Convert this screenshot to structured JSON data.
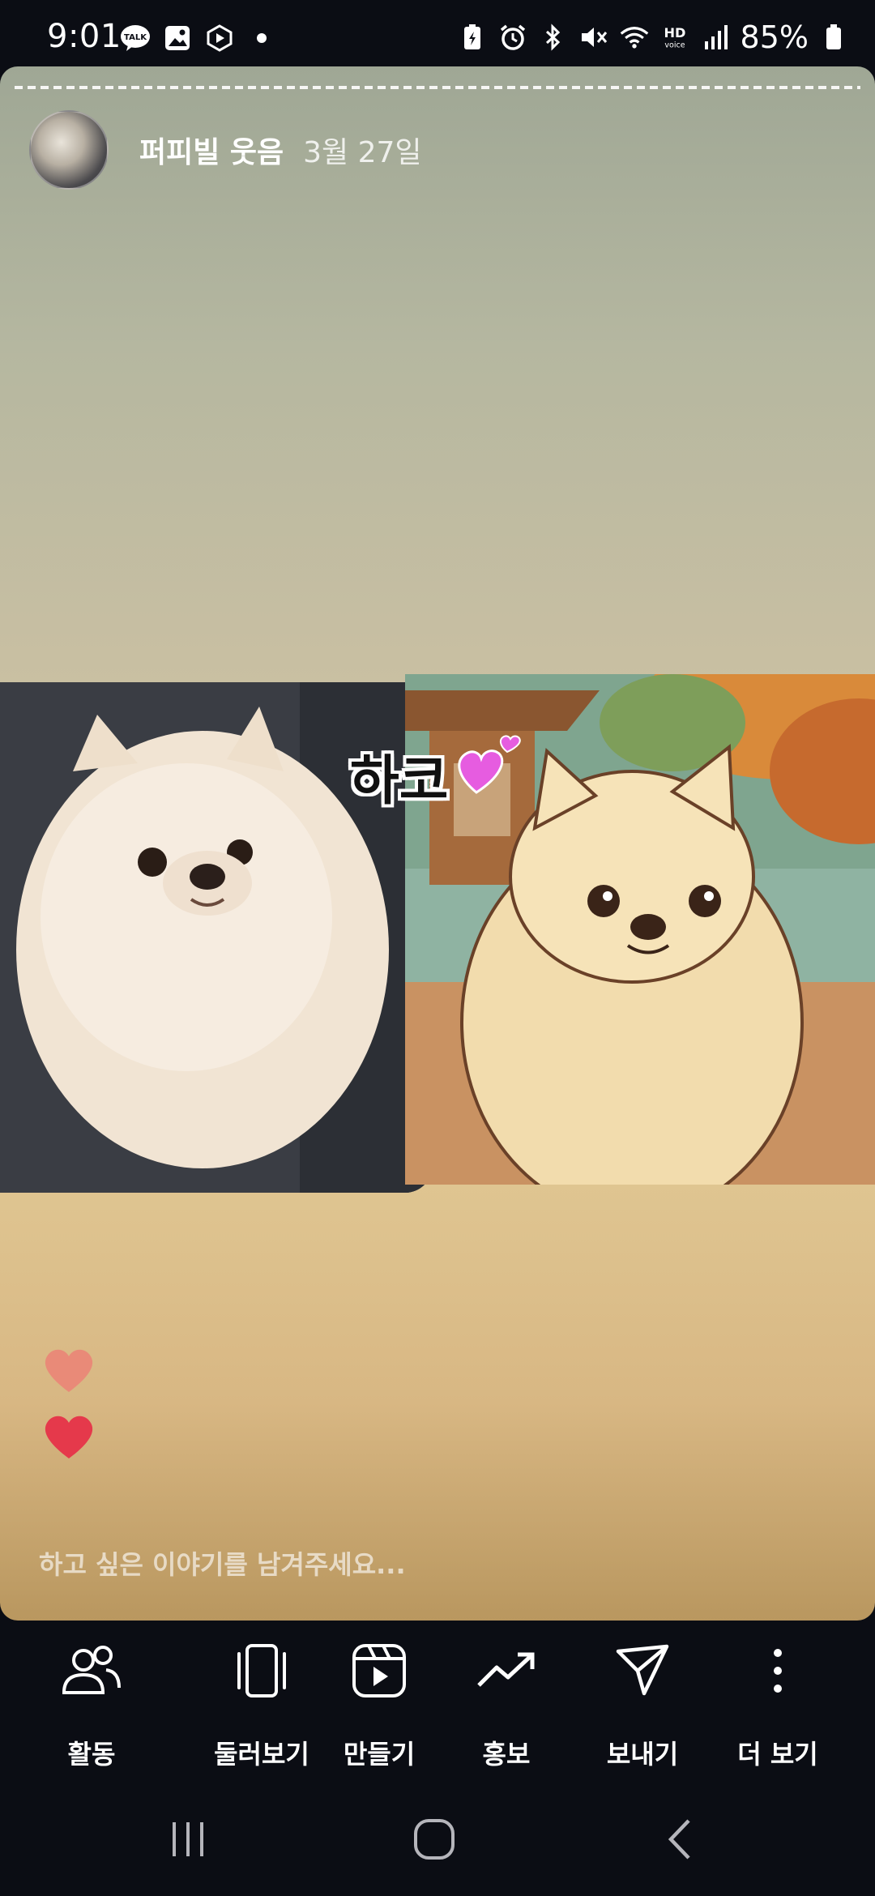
{
  "status_bar": {
    "time": "9:01",
    "battery_percent": "85%",
    "left_icons": [
      "kakaotalk-icon",
      "gallery-icon",
      "play-store-icon",
      "dot-icon"
    ],
    "right_icons": [
      "battery-saver-icon",
      "alarm-icon",
      "bluetooth-icon",
      "mute-icon",
      "wifi-icon",
      "hd-voice-icon",
      "signal-icon",
      "battery-icon"
    ]
  },
  "story": {
    "username": "퍼피빌 웃음",
    "date": "3월 27일",
    "tag_text": "하코",
    "reply_placeholder": "하고 싶은 이야기를 남겨주세요..."
  },
  "actions": [
    {
      "label": "활동",
      "icon": "activity-people-icon"
    },
    {
      "label": "둘러보기",
      "icon": "explore-card-icon"
    },
    {
      "label": "만들기",
      "icon": "reels-create-icon"
    },
    {
      "label": "홍보",
      "icon": "trending-up-icon"
    },
    {
      "label": "보내기",
      "icon": "send-icon"
    },
    {
      "label": "더 보기",
      "icon": "more-vertical-icon"
    }
  ],
  "nav": [
    "recent-apps-icon",
    "home-icon",
    "back-icon"
  ],
  "colors": {
    "heart_light": "#e98a78",
    "heart_strong": "#e5394b",
    "sticker_heart": "#e65ce0",
    "background": "#0b0d14"
  }
}
